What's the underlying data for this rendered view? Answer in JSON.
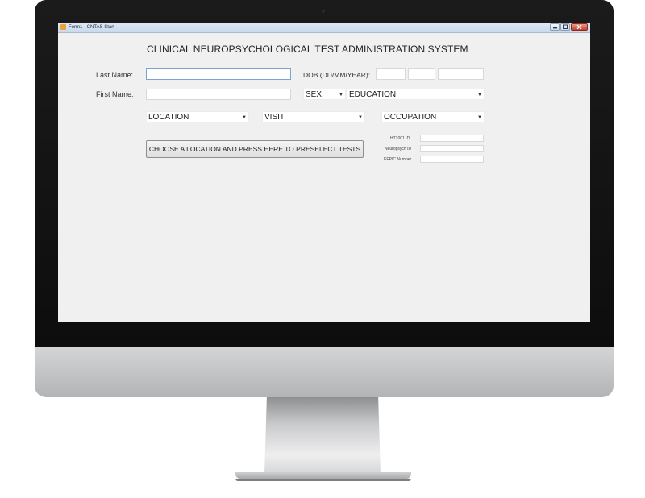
{
  "window": {
    "title": "Form1 - CNTAS Start",
    "controls": [
      "minimize",
      "maximize",
      "close"
    ]
  },
  "form": {
    "heading": "CLINICAL NEUROPSYCHOLOGICAL TEST ADMINISTRATION SYSTEM",
    "last_name": {
      "label": "Last Name:",
      "value": ""
    },
    "first_name": {
      "label": "First Name:",
      "value": ""
    },
    "dob": {
      "label": "DOB (DD/MM/YEAR):",
      "day": "",
      "month": "",
      "year": ""
    },
    "sex": {
      "selected": "SEX"
    },
    "education": {
      "selected": "EDUCATION"
    },
    "location": {
      "selected": "LOCATION"
    },
    "visit": {
      "selected": "VISIT"
    },
    "occupation": {
      "selected": "OCCUPATION"
    },
    "preselect_button": "CHOOSE A LOCATION AND PRESS HERE TO PRESELECT TESTS",
    "ids": {
      "ht1001": {
        "label": "HT1001 ID",
        "value": ""
      },
      "neuropsych": {
        "label": "Neuropsych ID",
        "value": ""
      },
      "eepic": {
        "label": "EEPIC Number",
        "value": ""
      }
    }
  },
  "icons": {
    "app": "app-icon",
    "dropdown": "dropdown-arrow-icon"
  },
  "colors": {
    "form_background": "#f0f0f0",
    "titlebar": "#c9d9ec",
    "close_button": "#c7412c",
    "input_focus_border": "#7da2ce"
  }
}
